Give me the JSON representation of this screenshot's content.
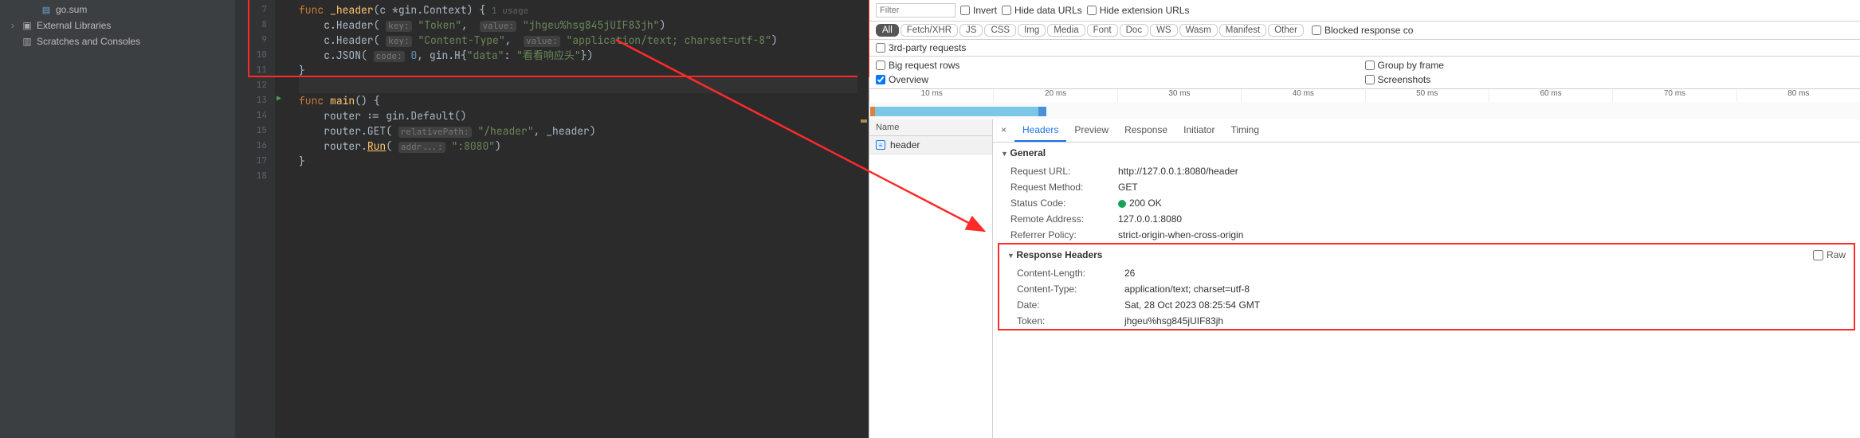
{
  "sidebar": {
    "items": [
      {
        "label": "go.sum",
        "icon": "file-go-icon",
        "indent": "indent1"
      },
      {
        "label": "External Libraries",
        "icon": "library-icon",
        "indent": "indent0",
        "chevron": "›"
      },
      {
        "label": "Scratches and Consoles",
        "icon": "scratch-icon",
        "indent": "indent0"
      }
    ]
  },
  "editor": {
    "lines": [
      7,
      8,
      9,
      10,
      11,
      12,
      13,
      14,
      15,
      16,
      17,
      18
    ],
    "run_marker_line": 13,
    "code": {
      "l7": {
        "kw": "func ",
        "fn": "_header",
        "rest1": "(c *gin.Context) {",
        "usage": "1 usage"
      },
      "l8": {
        "indent": "    ",
        "call": "c.Header(",
        "hint1": "key:",
        "str1": "\"Token\"",
        "comma": ",  ",
        "hint2": "value:",
        "str2": "\"jhgeu%hsg845jUIF83jh\"",
        "close": ")"
      },
      "l9": {
        "indent": "    ",
        "call": "c.Header(",
        "hint1": "key:",
        "str1": "\"Content-Type\"",
        "comma": ",  ",
        "hint2": "value:",
        "str2": "\"application/text; charset=utf-8\"",
        "close": ")"
      },
      "l10": {
        "indent": "    ",
        "call": "c.JSON(",
        "hint1": "code:",
        "num": "0",
        "comma": ", gin.H{",
        "str1": "\"data\"",
        "colon": ": ",
        "str2": "\"看看响应头\"",
        "close": "})"
      },
      "l11": {
        "text": "}"
      },
      "l12": {
        "text": ""
      },
      "l13": {
        "kw": "func ",
        "fn": "main",
        "rest": "() {"
      },
      "l14": {
        "indent": "    ",
        "text": "router := gin.Default()"
      },
      "l15": {
        "indent": "    ",
        "call": "router.GET(",
        "hint1": "relativePath:",
        "str1": "\"/header\"",
        "rest": ", _header)"
      },
      "l16": {
        "indent": "    ",
        "call": "router.",
        "fn": "Run",
        "open": "(",
        "hint1": "addr...:",
        "str1": "\":8080\"",
        "close": ")"
      },
      "l17": {
        "text": "}"
      },
      "l18": {
        "text": ""
      }
    }
  },
  "devtools": {
    "filter_placeholder": "Filter",
    "checks_row1": [
      "Invert",
      "Hide data URLs",
      "Hide extension URLs"
    ],
    "type_pills": [
      "All",
      "Fetch/XHR",
      "JS",
      "CSS",
      "Img",
      "Media",
      "Font",
      "Doc",
      "WS",
      "Wasm",
      "Manifest",
      "Other"
    ],
    "active_pill": "All",
    "blocked_label": "Blocked response co",
    "thirdparty_label": "3rd-party requests",
    "option_cols": [
      [
        "Big request rows",
        "Overview"
      ],
      [
        "Group by frame",
        "Screenshots"
      ]
    ],
    "option_checked": {
      "Overview": true
    },
    "timeline_ticks": [
      "10 ms",
      "20 ms",
      "30 ms",
      "40 ms",
      "50 ms",
      "60 ms",
      "70 ms",
      "80 ms"
    ],
    "req_list_header": "Name",
    "requests": [
      {
        "name": "header",
        "icon": "doc-icon"
      }
    ],
    "detail_tabs": [
      "Headers",
      "Preview",
      "Response",
      "Initiator",
      "Timing"
    ],
    "active_detail_tab": "Headers",
    "general_title": "General",
    "general": [
      {
        "k": "Request URL:",
        "v": "http://127.0.0.1:8080/header"
      },
      {
        "k": "Request Method:",
        "v": "GET"
      },
      {
        "k": "Status Code:",
        "v": "200 OK",
        "status": true
      },
      {
        "k": "Remote Address:",
        "v": "127.0.0.1:8080"
      },
      {
        "k": "Referrer Policy:",
        "v": "strict-origin-when-cross-origin"
      }
    ],
    "response_headers_title": "Response Headers",
    "raw_label": "Raw",
    "response_headers": [
      {
        "k": "Content-Length:",
        "v": "26"
      },
      {
        "k": "Content-Type:",
        "v": "application/text; charset=utf-8"
      },
      {
        "k": "Date:",
        "v": "Sat, 28 Oct 2023 08:25:54 GMT"
      },
      {
        "k": "Token:",
        "v": "jhgeu%hsg845jUIF83jh"
      }
    ]
  }
}
